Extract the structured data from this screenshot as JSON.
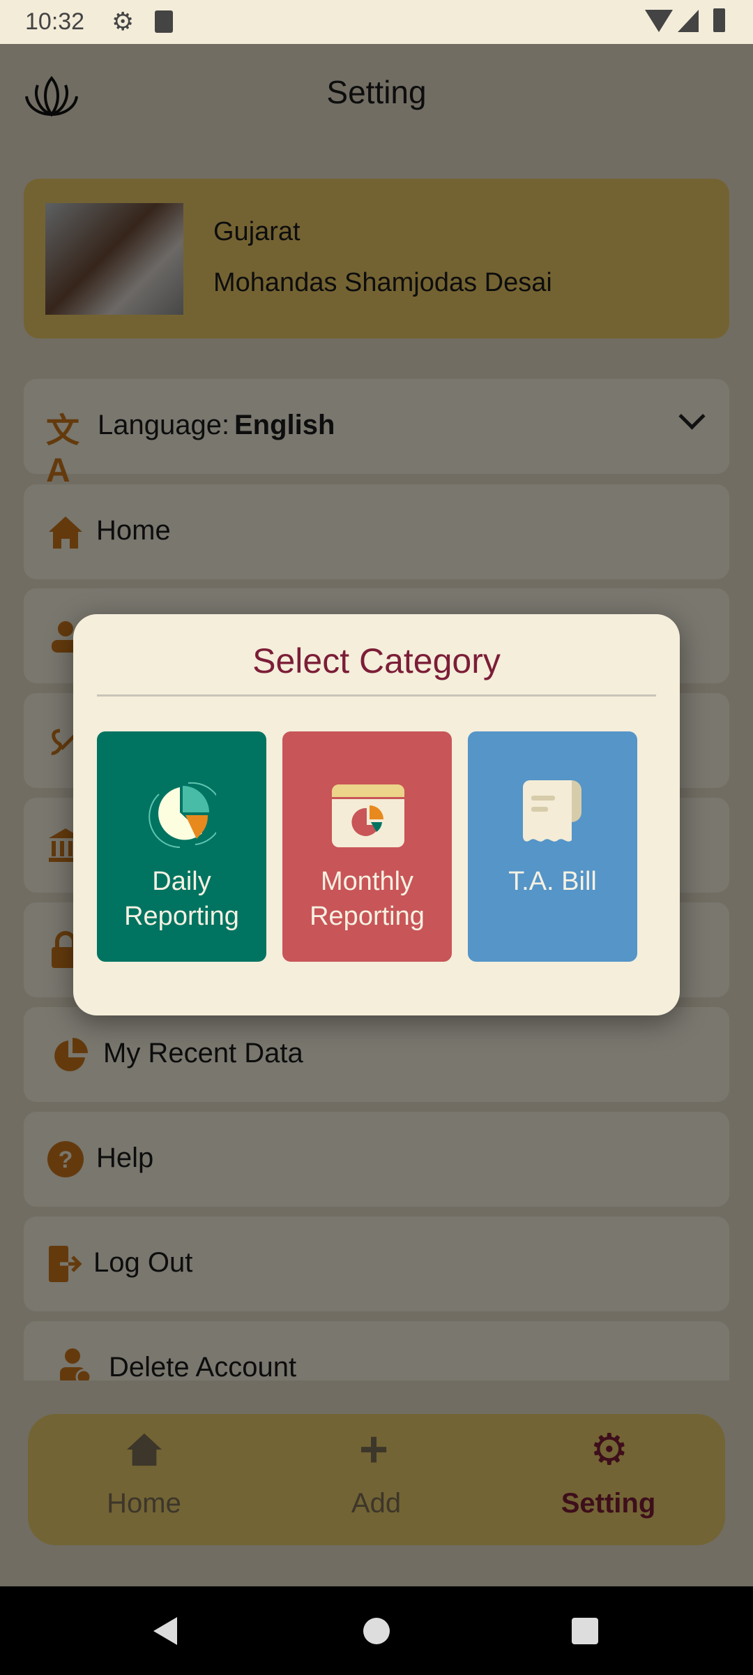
{
  "status_bar": {
    "time": "10:32",
    "icons": [
      "gear-icon",
      "sd-card-icon",
      "wifi-off-icon",
      "signal-icon",
      "battery-icon"
    ]
  },
  "header": {
    "title": "Setting",
    "logo": "lotus-icon"
  },
  "profile": {
    "state": "Gujarat",
    "name": "Mohandas Shamjodas Desai"
  },
  "menu": {
    "language_label": "Language:",
    "language_value": "English",
    "items": [
      {
        "label": "Home",
        "icon": "home-icon"
      },
      {
        "label": "My Recent Data",
        "icon": "pie-chart-icon"
      },
      {
        "label": "Help",
        "icon": "help-icon"
      },
      {
        "label": "Log Out",
        "icon": "logout-icon"
      },
      {
        "label": "Delete Account",
        "icon": "delete-user-icon"
      }
    ]
  },
  "bottom_nav": {
    "items": [
      {
        "label": "Home"
      },
      {
        "label": "Add"
      },
      {
        "label": "Setting",
        "active": true
      }
    ]
  },
  "dialog": {
    "title": "Select Category",
    "options": [
      {
        "line1": "Daily",
        "line2": "Reporting",
        "color": "#007461"
      },
      {
        "line1": "Monthly",
        "line2": "Reporting",
        "color": "#c85558"
      },
      {
        "line1": "",
        "line2": "T.A. Bill",
        "color": "#5595c8"
      }
    ]
  },
  "colors": {
    "accent": "#7c1d37",
    "icon_orange": "#c8741a"
  }
}
